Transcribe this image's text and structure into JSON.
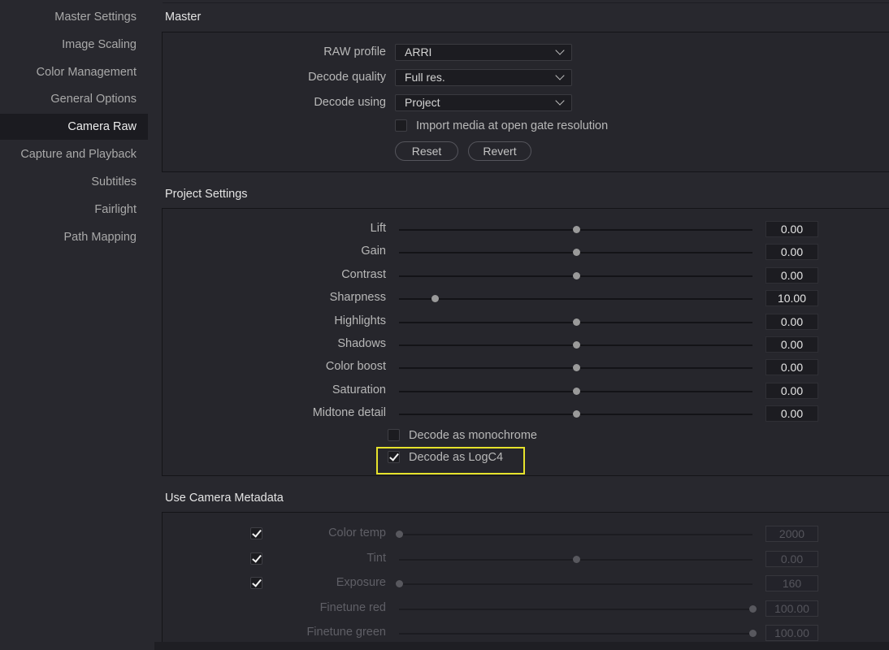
{
  "sidebar": {
    "items": [
      {
        "label": "Master Settings",
        "active": false
      },
      {
        "label": "Image Scaling",
        "active": false
      },
      {
        "label": "Color Management",
        "active": false
      },
      {
        "label": "General Options",
        "active": false
      },
      {
        "label": "Camera Raw",
        "active": true
      },
      {
        "label": "Capture and Playback",
        "active": false
      },
      {
        "label": "Subtitles",
        "active": false
      },
      {
        "label": "Fairlight",
        "active": false
      },
      {
        "label": "Path Mapping",
        "active": false
      }
    ]
  },
  "master": {
    "title": "Master",
    "raw_profile": {
      "label": "RAW profile",
      "value": "ARRI"
    },
    "decode_quality": {
      "label": "Decode quality",
      "value": "Full res."
    },
    "decode_using": {
      "label": "Decode using",
      "value": "Project"
    },
    "open_gate": {
      "label": "Import media at open gate resolution",
      "checked": false
    },
    "reset_label": "Reset",
    "revert_label": "Revert"
  },
  "project": {
    "title": "Project Settings",
    "sliders": [
      {
        "label": "Lift",
        "value": "0.00",
        "fraction": 0.5
      },
      {
        "label": "Gain",
        "value": "0.00",
        "fraction": 0.5
      },
      {
        "label": "Contrast",
        "value": "0.00",
        "fraction": 0.5
      },
      {
        "label": "Sharpness",
        "value": "10.00",
        "fraction": 0.1
      },
      {
        "label": "Highlights",
        "value": "0.00",
        "fraction": 0.5
      },
      {
        "label": "Shadows",
        "value": "0.00",
        "fraction": 0.5
      },
      {
        "label": "Color boost",
        "value": "0.00",
        "fraction": 0.5
      },
      {
        "label": "Saturation",
        "value": "0.00",
        "fraction": 0.5
      },
      {
        "label": "Midtone detail",
        "value": "0.00",
        "fraction": 0.5
      }
    ],
    "monochrome": {
      "label": "Decode as monochrome",
      "checked": false
    },
    "logc4": {
      "label": "Decode as LogC4",
      "checked": true
    }
  },
  "metadata": {
    "title": "Use Camera Metadata",
    "rows": [
      {
        "label": "Color temp",
        "value": "2000",
        "fraction": 0.0,
        "checked": true
      },
      {
        "label": "Tint",
        "value": "0.00",
        "fraction": 0.5,
        "checked": true
      },
      {
        "label": "Exposure",
        "value": "160",
        "fraction": 0.0,
        "checked": true
      },
      {
        "label": "Finetune red",
        "value": "100.00",
        "fraction": 1.0
      },
      {
        "label": "Finetune green",
        "value": "100.00",
        "fraction": 1.0
      }
    ]
  },
  "colors": {
    "highlight": "#e6e22c",
    "background": "#28282e",
    "active_item": "#1b1b20"
  }
}
